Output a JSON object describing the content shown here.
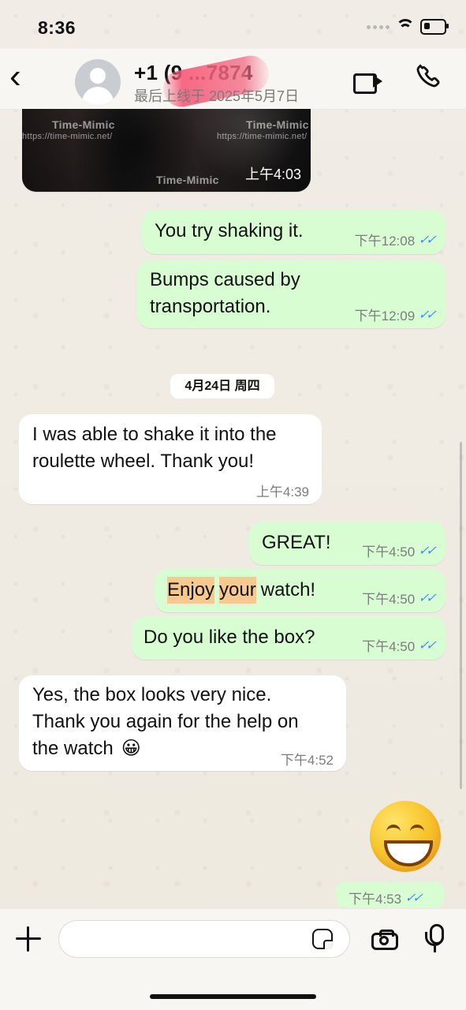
{
  "status_bar": {
    "time": "8:36"
  },
  "header": {
    "contact_name": "+1 (9 ...7874",
    "contact_subtitle": "最后上线于 2025年5月7日"
  },
  "watermarks": {
    "brand": "Time-Mimic",
    "url": "https://time-mimic.net/"
  },
  "messages": {
    "media_time": "上午4:03",
    "m1_text": "You try shaking it.",
    "m1_time": "下午12:08",
    "m2_line1": "Bumps caused by",
    "m2_line2": "transportation.",
    "m2_time": "下午12:09",
    "date_separator": "4月24日 周四",
    "m3_line1": "I was able to shake it into the",
    "m3_line2": "roulette wheel. Thank you!",
    "m3_time": "上午4:39",
    "m4_text": "GREAT!",
    "m4_time": "下午4:50",
    "m5_word1": "Enjoy",
    "m5_word2": "your",
    "m5_word3": "watch!",
    "m5_time": "下午4:50",
    "m6_text": "Do you like the box?",
    "m6_time": "下午4:50",
    "m7_line1": "Yes, the box looks very nice.",
    "m7_line2": "Thank you again for the help on",
    "m7_line3": "the watch",
    "m7_emoji": "😀",
    "m7_time": "下午4:52",
    "emoji_message_time": "下午4:53"
  },
  "icons": {
    "back": "back-icon",
    "video": "video-call-icon",
    "phone": "phone-icon",
    "plus": "plus-icon",
    "sticker": "sticker-icon",
    "camera": "camera-icon",
    "mic": "mic-icon",
    "read_receipt": "double-check-icon"
  },
  "colors": {
    "outgoing_bubble": "#d8fdd3",
    "incoming_bubble": "#ffffff",
    "read_receipt": "#3b8cff",
    "highlight": "#f5c98f"
  }
}
